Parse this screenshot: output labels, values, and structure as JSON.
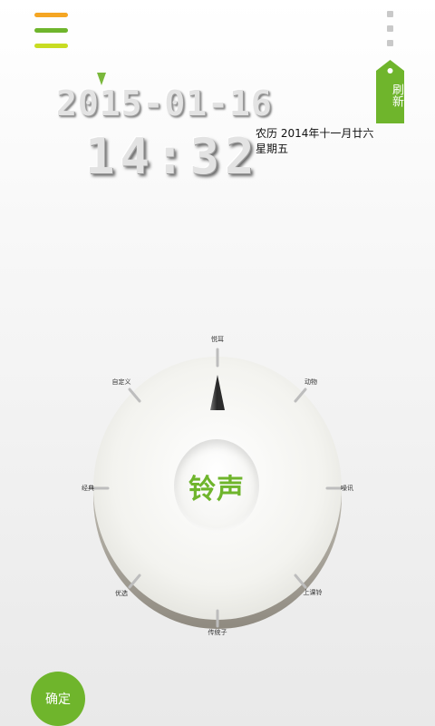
{
  "header": {
    "menu_icon": "hamburger-menu-icon",
    "menu_colors": [
      "#f5a623",
      "#6fb52c",
      "#c8dc22"
    ],
    "overflow_icon": "overflow-dots-icon",
    "refresh_label": "刷新",
    "accent": "#6fb52c"
  },
  "clock": {
    "date": "2015-01-16",
    "time": "14:32",
    "lunar": "农历 2014年十一月廿六",
    "weekday": "星期五"
  },
  "dial": {
    "center_label": "铃声",
    "ticks": [
      {
        "label": "悦耳"
      },
      {
        "label": "动物"
      },
      {
        "label": "噪讯"
      },
      {
        "label": "上课铃"
      },
      {
        "label": "传统子"
      },
      {
        "label": "优选"
      },
      {
        "label": "经典"
      },
      {
        "label": "自定义"
      }
    ]
  },
  "footer": {
    "confirm_label": "确定"
  }
}
